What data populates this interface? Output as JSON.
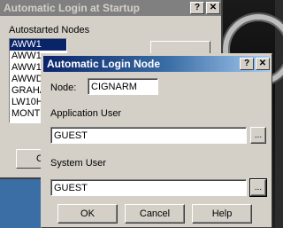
{
  "back_window": {
    "title": "Automatic Login at Startup",
    "help_btn": "?",
    "close_btn": "✕",
    "list_label": "Autostarted Nodes",
    "nodes": [
      "AWW1",
      "AWW1",
      "AWW1",
      "AWWD",
      "GRAHA",
      "LW10H",
      "MONT"
    ],
    "selected_index": 0,
    "partial_btn_left": "C"
  },
  "dialog": {
    "title": "Automatic Login Node",
    "help_btn": "?",
    "close_btn": "✕",
    "node_label": "Node:",
    "node_value": "CIGNARM",
    "app_user_label": "Application User",
    "app_user_value": "GUEST",
    "app_browse": "...",
    "sys_user_label": "System User",
    "sys_user_value": "GUEST",
    "sys_browse": "...",
    "ok": "OK",
    "cancel": "Cancel",
    "help": "Help"
  },
  "colors": {
    "face": "#d4d0c8",
    "active_title": "#0a246a",
    "inactive_title": "#808080",
    "selection": "#0a246a"
  }
}
